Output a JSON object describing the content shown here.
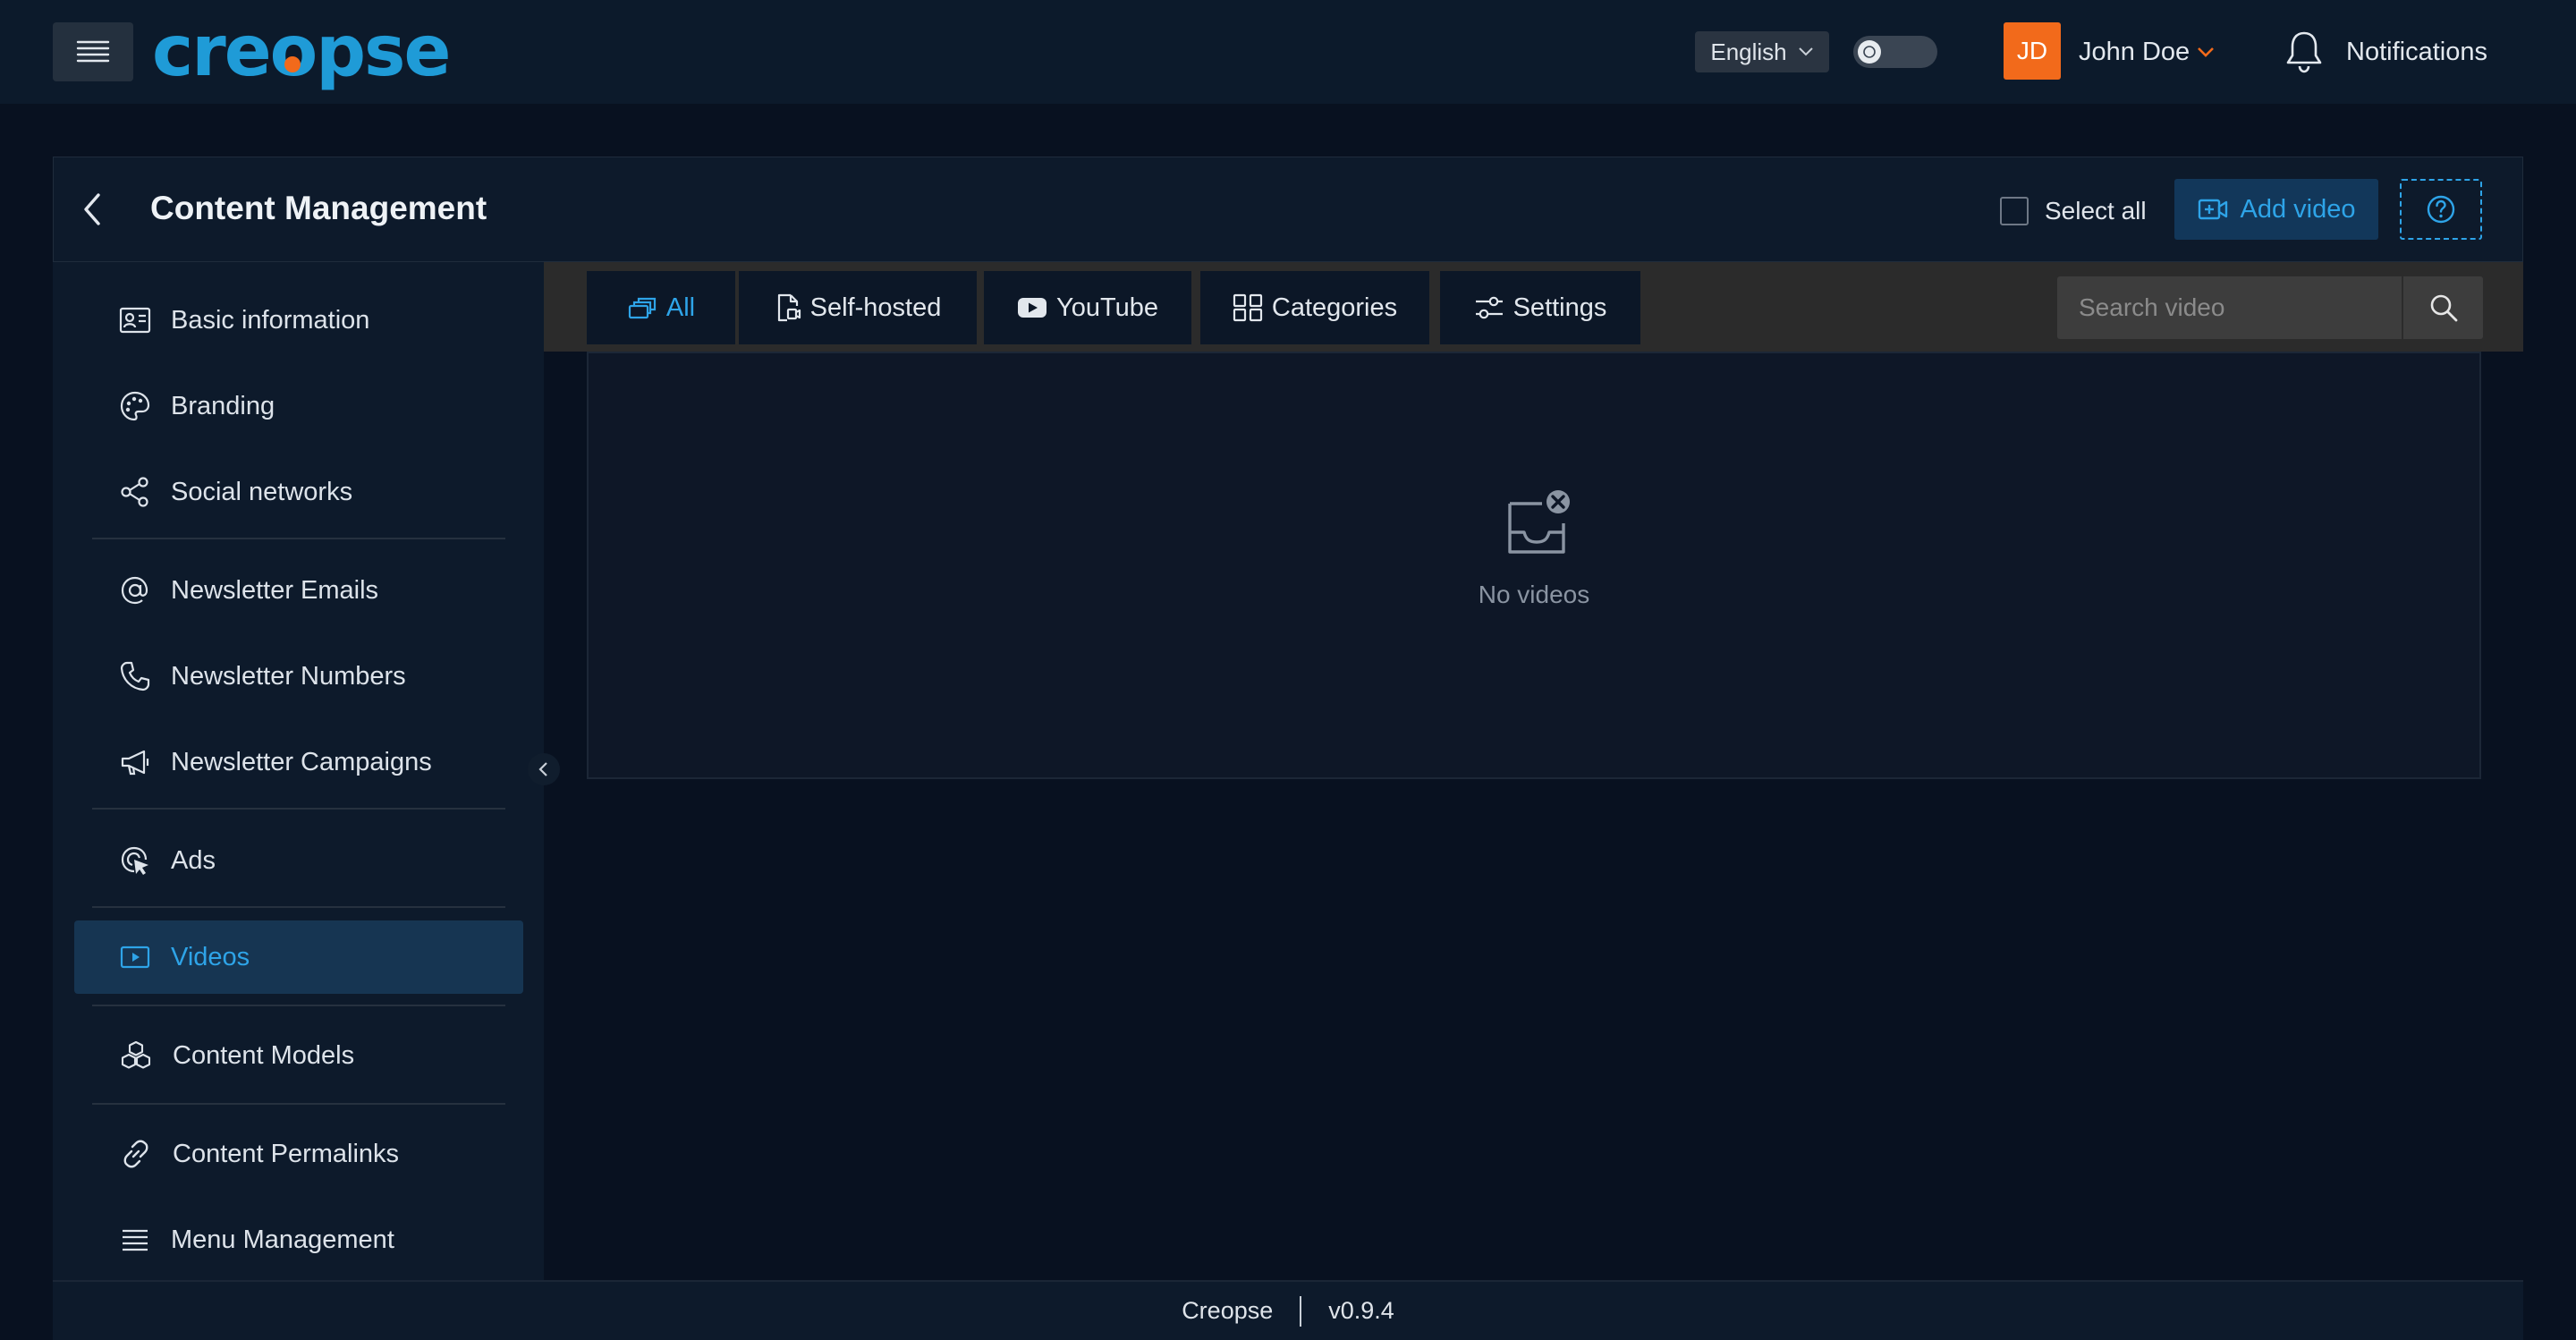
{
  "header": {
    "logo_text": "creopse",
    "language": "English",
    "user_initials": "JD",
    "user_name": "John Doe",
    "notifications_label": "Notifications"
  },
  "page": {
    "title": "Content Management",
    "select_all_label": "Select all",
    "add_video_label": "Add video"
  },
  "sidebar": {
    "items": [
      {
        "label": "Basic information",
        "icon": "id-card-icon"
      },
      {
        "label": "Branding",
        "icon": "palette-icon"
      },
      {
        "label": "Social networks",
        "icon": "share-icon"
      },
      {
        "label": "Newsletter Emails",
        "icon": "at-sign-icon"
      },
      {
        "label": "Newsletter Numbers",
        "icon": "phone-icon"
      },
      {
        "label": "Newsletter Campaigns",
        "icon": "megaphone-icon"
      },
      {
        "label": "Ads",
        "icon": "ads-click-icon"
      },
      {
        "label": "Videos",
        "icon": "video-icon",
        "active": true
      },
      {
        "label": "Content Models",
        "icon": "cubes-icon"
      },
      {
        "label": "Content Permalinks",
        "icon": "link-icon"
      },
      {
        "label": "Menu Management",
        "icon": "menu-icon"
      }
    ]
  },
  "tabs": [
    {
      "label": "All",
      "icon": "cards-icon",
      "active": true
    },
    {
      "label": "Self-hosted",
      "icon": "file-video-icon"
    },
    {
      "label": "YouTube",
      "icon": "youtube-icon"
    },
    {
      "label": "Categories",
      "icon": "categories-icon"
    },
    {
      "label": "Settings",
      "icon": "sliders-icon"
    }
  ],
  "search": {
    "placeholder": "Search video"
  },
  "empty_state": {
    "message": "No videos"
  },
  "footer": {
    "app_name": "Creopse",
    "version": "v0.9.4"
  },
  "colors": {
    "accent": "#2ea4e8",
    "brand_orange": "#f26a1b",
    "background": "#081120",
    "panel": "#0d1a2b"
  }
}
